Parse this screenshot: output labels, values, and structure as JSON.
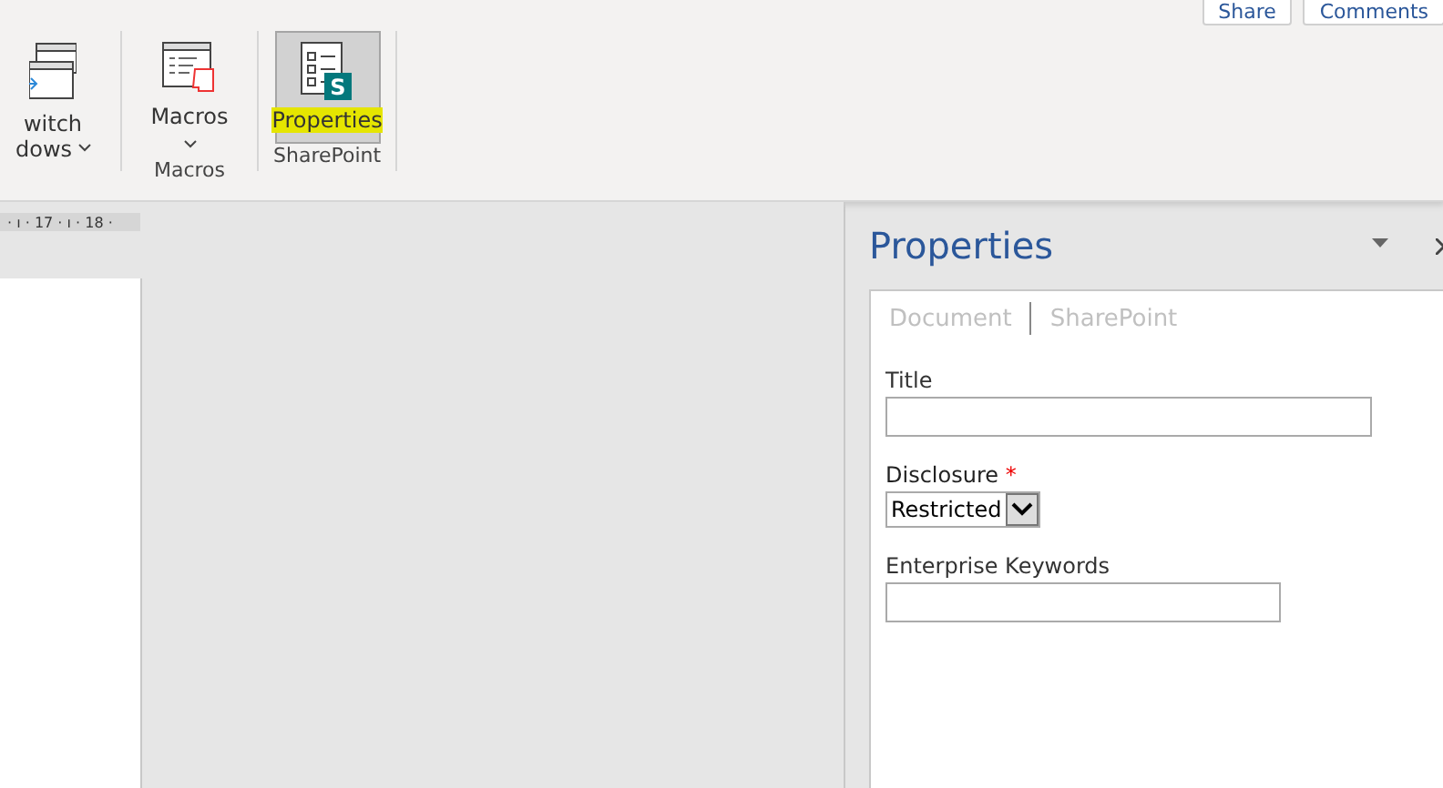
{
  "top_buttons": [
    {
      "label": "Share"
    },
    {
      "label": "Comments"
    }
  ],
  "ribbon": {
    "groups": [
      {
        "kind": "partial",
        "buttons": [
          {
            "kind": "windows",
            "line1": "witch",
            "line2": "dows",
            "caret": true,
            "selected": false,
            "highlighted": false
          }
        ]
      },
      {
        "kind": "normal",
        "label": "Macros",
        "buttons": [
          {
            "kind": "macros",
            "line1": "Macros",
            "caret": true,
            "selected": false,
            "highlighted": false
          }
        ]
      },
      {
        "kind": "normal",
        "label": "SharePoint",
        "buttons": [
          {
            "kind": "properties",
            "badge": "S",
            "line1": "Properties",
            "caret": false,
            "selected": true,
            "highlighted": true
          }
        ]
      }
    ]
  },
  "ruler": {
    "text": "· ı · 17 · ı · 18 ·"
  },
  "pane": {
    "title": "Properties",
    "tabs": [
      {
        "label": "Document"
      },
      {
        "label": "SharePoint"
      }
    ],
    "fields": [
      {
        "kind": "text",
        "label": "Title",
        "required": false
      },
      {
        "kind": "select",
        "label": "Disclosure",
        "required": true,
        "required_mark": "*",
        "value": "Restricted"
      },
      {
        "kind": "text",
        "label": "Enterprise Keywords",
        "required": false
      }
    ]
  }
}
